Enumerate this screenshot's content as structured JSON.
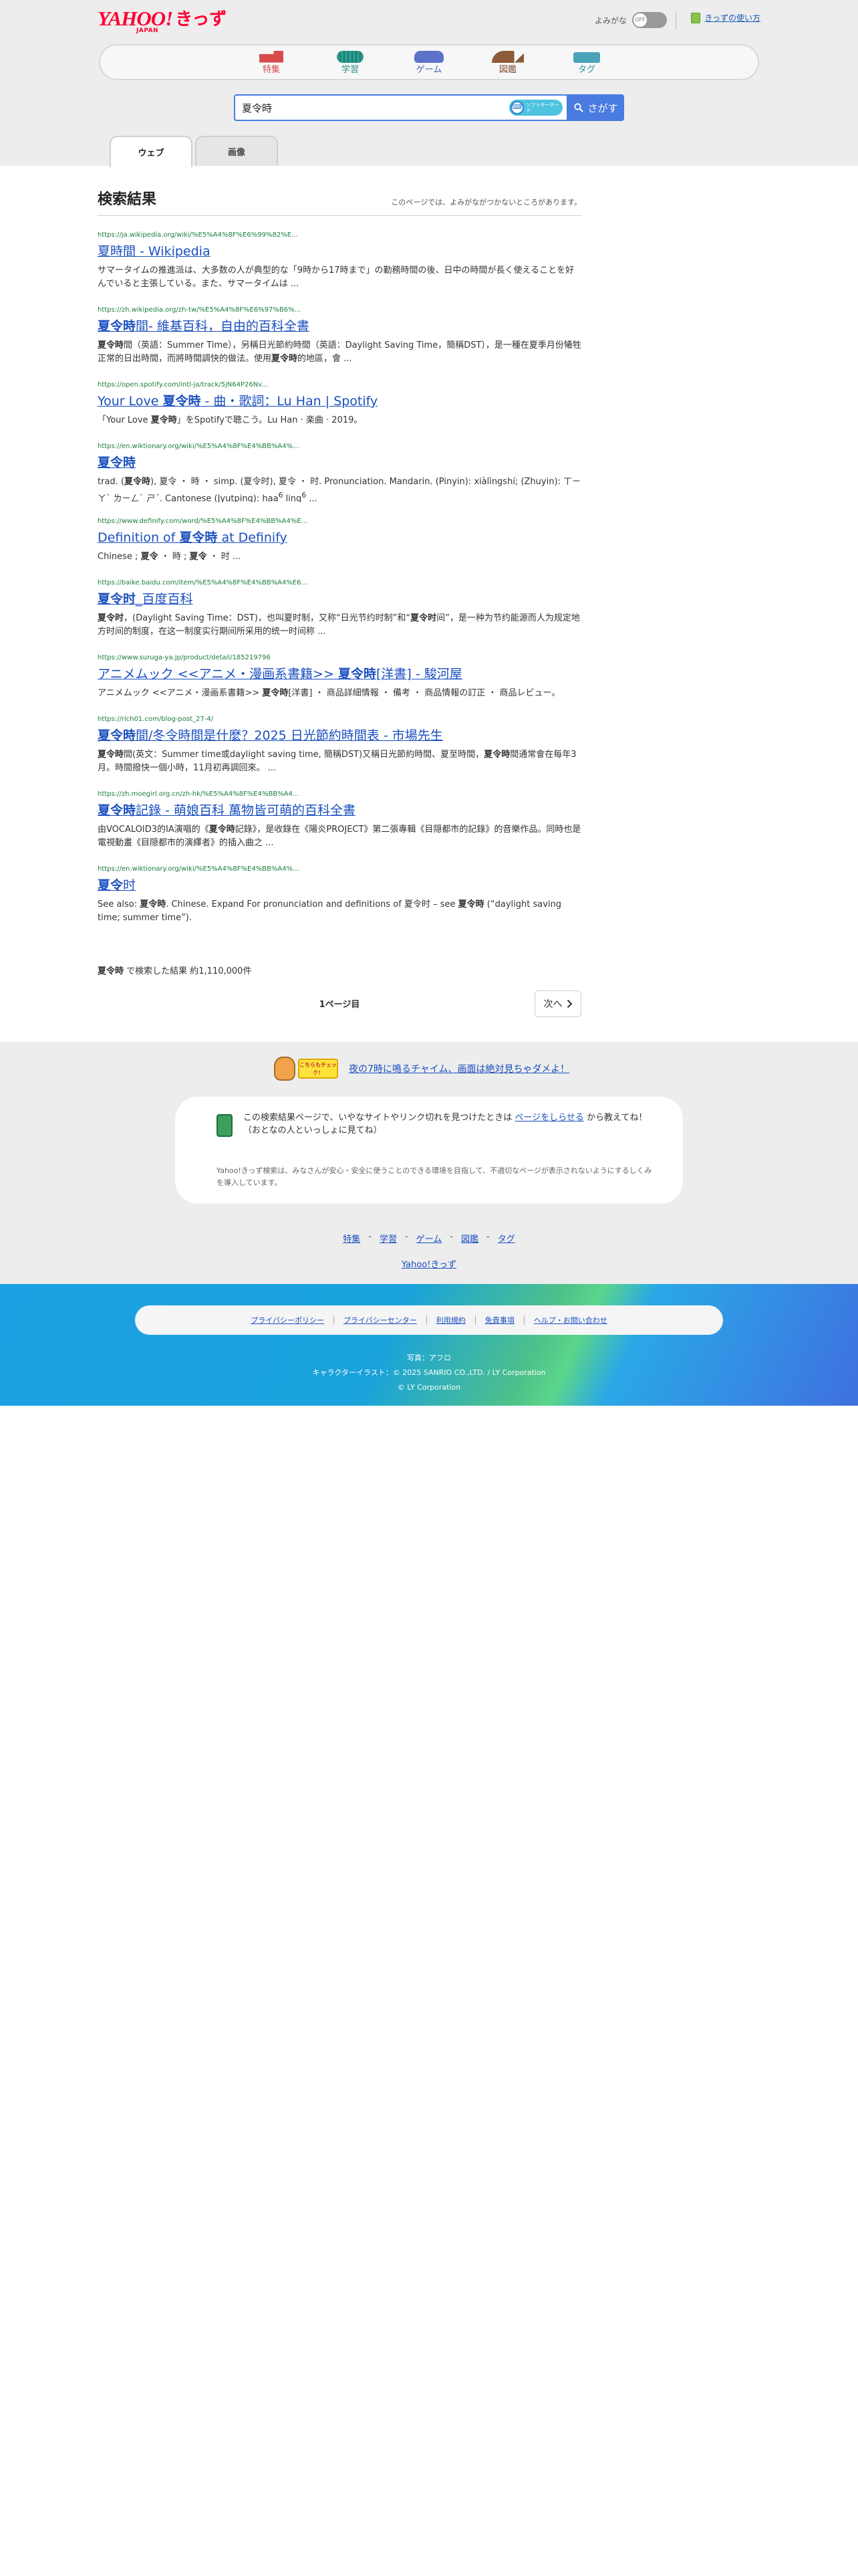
{
  "header": {
    "logo_main": "YAHOO!",
    "logo_kids": "きっず",
    "logo_sub": "JAPAN",
    "yomigana_label": "よみがな",
    "yomigana_state": "OFF",
    "howto_label": "きっずの使い方"
  },
  "nav": [
    {
      "label": "特集",
      "icon": "feature-icon"
    },
    {
      "label": "学習",
      "icon": "study-icon"
    },
    {
      "label": "ゲーム",
      "icon": "game-icon"
    },
    {
      "label": "図鑑",
      "icon": "zukan-icon"
    },
    {
      "label": "タグ",
      "icon": "tag-icon"
    }
  ],
  "search": {
    "value": "夏令時",
    "softkey_label": "ソフトキーボード",
    "button_label": "さがす"
  },
  "tabs": [
    {
      "label": "ウェブ",
      "active": true
    },
    {
      "label": "画像",
      "active": false
    }
  ],
  "results_header": {
    "title": "検索結果",
    "note": "このページでは、よみがながつかないところがあります。"
  },
  "results": [
    {
      "url": "https://ja.wikipedia.org/wiki/%E5%A4%8F%E6%99%82%E...",
      "title_html": "夏時間 - Wikipedia",
      "snippet_html": "サマータイムの推進派は、大多数の人が典型的な「9時から17時まで」の勤務時間の後、日中の時間が長く使えることを好んでいると主張している。また、サマータイムは ..."
    },
    {
      "url": "https://zh.wikipedia.org/zh-tw/%E5%A4%8F%E6%97%B6%...",
      "title_html": "<b>夏令時</b>間- 維基百科，自由的百科全書",
      "snippet_html": "<b>夏令時</b>間（英語：Summer Time），另稱日光節約時間（英語：Daylight Saving Time，簡稱DST），是一種在夏季月份犧牲正常的日出時間，而將時間調快的做法。使用<b>夏令時</b>的地區，會 ..."
    },
    {
      "url": "https://open.spotify.com/intl-ja/track/5jN64P26Nv...",
      "title_html": "Your Love <b>夏令時</b> - 曲・歌詞：Lu Han | Spotify",
      "snippet_html": "「Your Love <b>夏令時</b>」をSpotifyで聴こう。Lu Han · 楽曲 · 2019。"
    },
    {
      "url": "https://en.wiktionary.org/wiki/%E5%A4%8F%E4%BB%A4%...",
      "title_html": "<b>夏令時</b>",
      "snippet_html": "trad. (<b>夏令時</b>), 夏令 ・ 時 ・ simp. (夏令时), 夏令 ・ 时. Pronunciation. Mandarin. (Pinyin): xiàlìngshí; (Zhuyin): ㄒㄧㄚˋ ㄌㄧㄥˋ ㄕˊ. Cantonese (Jyutping): haa<sup>6</sup> ling<sup>6</sup> ..."
    },
    {
      "url": "https://www.definify.com/word/%E5%A4%8F%E4%BB%A4%E...",
      "title_html": "Definition of <b>夏令時</b> at Definify",
      "snippet_html": "Chinese ; <b>夏令</b> ・ 時 ; <b>夏令</b> ・ 时 ..."
    },
    {
      "url": "https://baike.baidu.com/item/%E5%A4%8F%E4%BB%A4%E6...",
      "title_html": "<b>夏令时</b>_百度百科",
      "snippet_html": "<b>夏令时</b>，(Daylight Saving Time：DST)，也叫夏时制，又称“日光节约时制”和“<b>夏令时</b>间”，是一种为节约能源而人为规定地方时间的制度，在这一制度实行期间所采用的统一时间称 ..."
    },
    {
      "url": "https://www.suruga-ya.jp/product/detail/185219796",
      "title_html": "アニメムック <<アニメ・漫画系書籍>> <b>夏令時</b>[洋書] - 駿河屋",
      "snippet_html": "アニメムック <<アニメ・漫画系書籍>> <b>夏令時</b>[洋書] ・ 商品詳細情報 ・ 備考 ・ 商品情報の訂正 ・ 商品レビュー。"
    },
    {
      "url": "https://rich01.com/blog-post_27-4/",
      "title_html": "<b>夏令時</b>間/冬令時間是什麼？2025 日光節約時間表 - 市場先生",
      "snippet_html": "<b>夏令時</b>間(英文：Summer time或daylight saving time, 簡稱DST)又稱日光節約時間、夏至時間，<b>夏令時</b>間通常會在每年3月。時間撥快一個小時，11月初再調回來。 ..."
    },
    {
      "url": "https://zh.moegirl.org.cn/zh-hk/%E5%A4%8F%E4%BB%A4...",
      "title_html": "<b>夏令時</b>記錄 - 萌娘百科 萬物皆可萌的百科全書",
      "snippet_html": "由VOCALOID3的IA演唱的《<b>夏令時</b>記錄》，是收錄在《陽炎PROJECT》第二張專輯《目隠都市的記錄》的音樂作品。同時也是電視動畫《目隠都市的演繹者》的插入曲之 ..."
    },
    {
      "url": "https://en.wiktionary.org/wiki/%E5%A4%8F%E4%BB%A4%...",
      "title_html": "<b>夏令</b>时",
      "snippet_html": "See also: <b>夏令時</b>. Chinese. Expand For pronunciation and definitions of 夏令时 – see <b>夏令時</b> (“daylight saving time; summer time”)."
    }
  ],
  "count_line_html": "<b>夏令時</b> で検索した結果 約1,110,000件",
  "pager": {
    "page_label": "1ページ目",
    "next_label": "次へ"
  },
  "chime": {
    "badge_label": "こちらもチェック！",
    "link_text": "夜の7時に鳴るチャイム、画面は絶対見ちゃダメよ！"
  },
  "report": {
    "text_before": "この検索結果ページで、いやなサイトやリンク切れを見つけたときは ",
    "link": "ページをしらせる",
    "text_after": " から教えてね！",
    "text_line2": "（おとなの人といっしょに見てね）",
    "sub": "Yahoo!きっず検索は、みなさんが安心・安全に使うことのできる環境を目指して、不適切なページが表示されないようにするしくみを導入しています。"
  },
  "footer_nav": [
    "特集",
    "学習",
    "ゲーム",
    "図鑑",
    "タグ"
  ],
  "footer_home": "Yahoo!きっず",
  "policy_links": [
    "プライバシーポリシー",
    "プライバシーセンター",
    "利用規約",
    "免責事項",
    "ヘルプ・お問い合わせ"
  ],
  "credits": [
    "写真：アフロ",
    "キャラクターイラスト：© 2025 SANRIO CO.,LTD. / LY Corporation",
    "© LY Corporation"
  ],
  "colors": {
    "accent_blue": "#4a7be0",
    "link_blue": "#1a4fbf",
    "url_green": "#1a7f3c",
    "brand_red": "#ff0033"
  }
}
